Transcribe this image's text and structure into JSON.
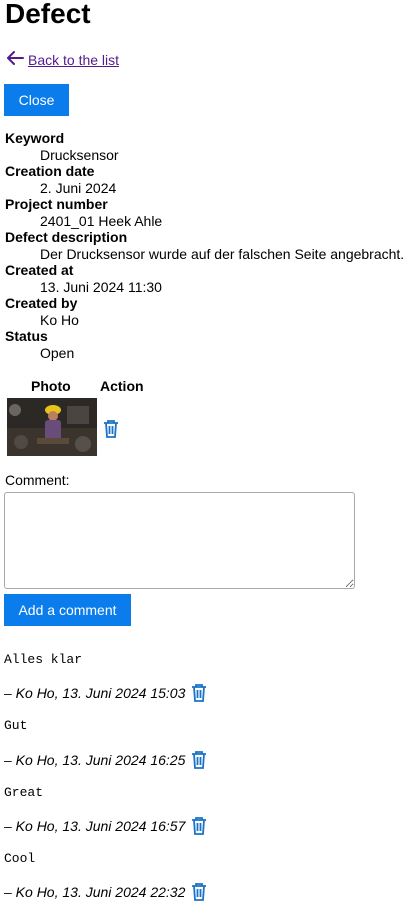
{
  "page": {
    "title": "Defect",
    "back_label": "Back to the list",
    "close_label": "Close"
  },
  "details": [
    {
      "label": "Keyword",
      "value": "Drucksensor"
    },
    {
      "label": "Creation date",
      "value": "2. Juni 2024"
    },
    {
      "label": "Project number",
      "value": "2401_01 Heek Ahle"
    },
    {
      "label": "Defect description",
      "value": "Der Drucksensor wurde auf der falschen Seite angebracht."
    },
    {
      "label": "Created at",
      "value": "13. Juni 2024 11:30"
    },
    {
      "label": "Created by",
      "value": "Ko Ho"
    },
    {
      "label": "Status",
      "value": "Open"
    }
  ],
  "photos": {
    "col_photo": "Photo",
    "col_action": "Action"
  },
  "comment_form": {
    "label": "Comment:",
    "value": "",
    "submit_label": "Add a comment"
  },
  "comments": [
    {
      "text": "Alles klar",
      "meta": "– Ko Ho, 13. Juni 2024 15:03"
    },
    {
      "text": "Gut",
      "meta": "– Ko Ho, 13. Juni 2024 16:25"
    },
    {
      "text": "Great",
      "meta": "– Ko Ho, 13. Juni 2024 16:57"
    },
    {
      "text": "Cool",
      "meta": "– Ko Ho, 13. Juni 2024 22:32"
    }
  ],
  "colors": {
    "button": "#0a7cec",
    "link": "#551a8b",
    "trash": "#1a73c8"
  },
  "icons": {
    "back": "arrow-left-icon",
    "delete": "trash-icon"
  }
}
